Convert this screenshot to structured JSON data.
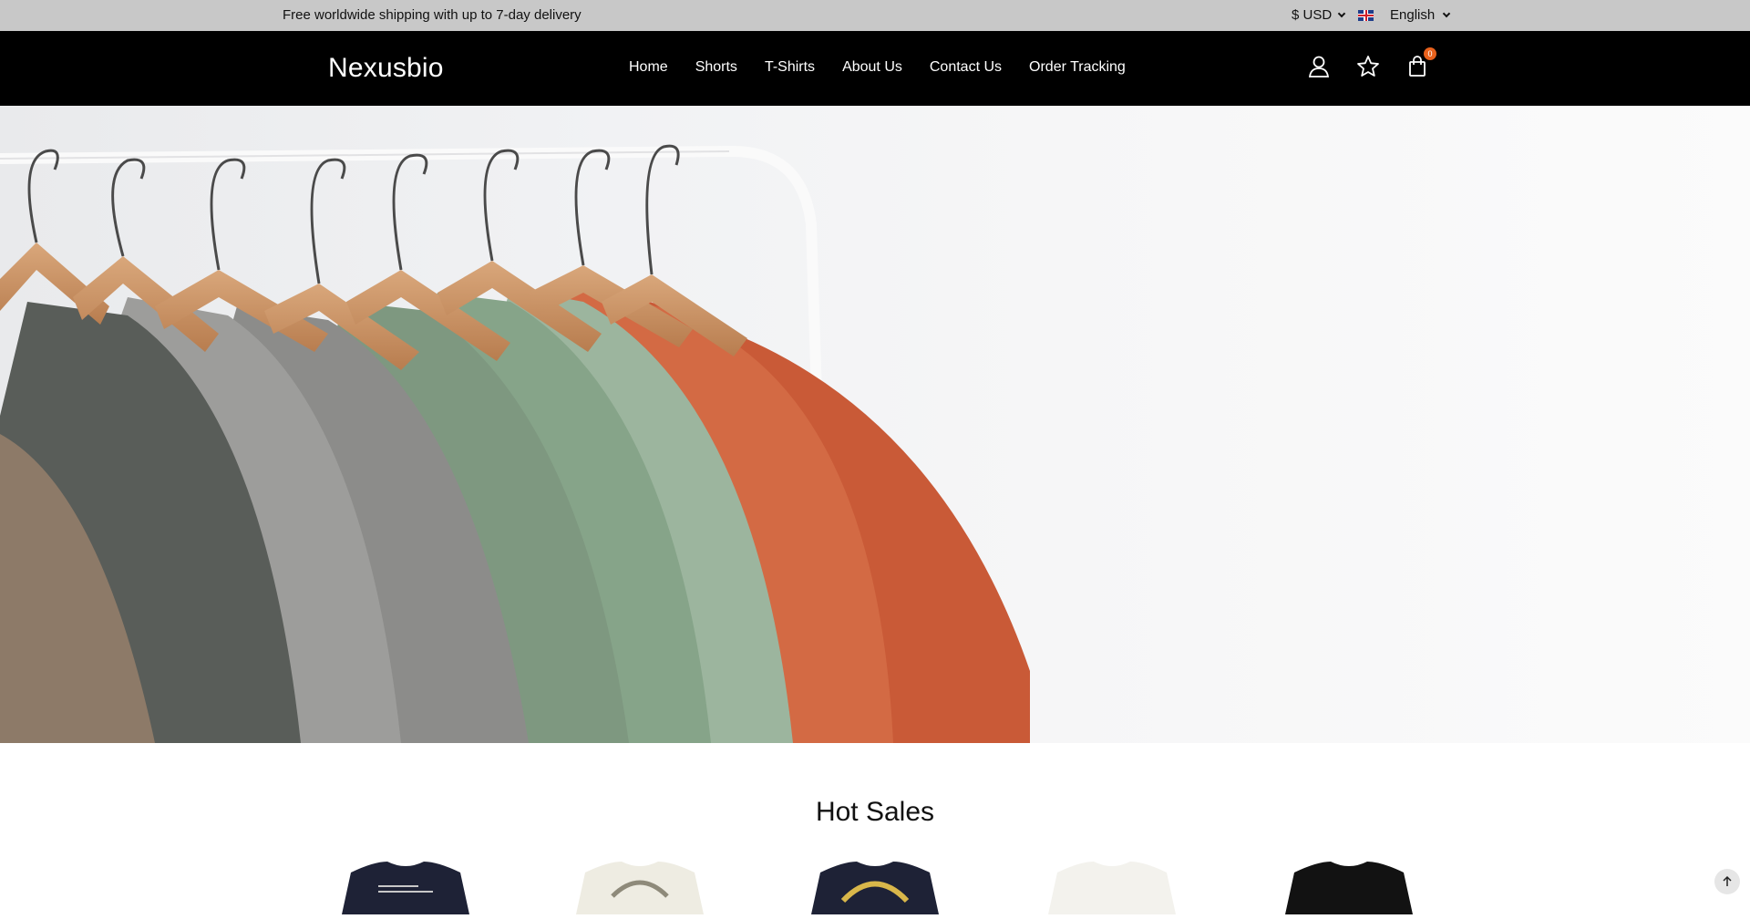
{
  "topbar": {
    "message": "Free worldwide shipping with up to 7-day delivery",
    "currency": "$ USD",
    "language": "English"
  },
  "header": {
    "logo": "Nexusbio",
    "nav": [
      {
        "label": "Home"
      },
      {
        "label": "Shorts"
      },
      {
        "label": "T-Shirts"
      },
      {
        "label": "About Us"
      },
      {
        "label": "Contact Us"
      },
      {
        "label": "Order Tracking"
      }
    ],
    "cart_count": "0",
    "icons": [
      "user-icon",
      "star-icon",
      "bag-icon"
    ]
  },
  "hero": {
    "image": "clothes-on-hangers-photo"
  },
  "hot_sales": {
    "title": "Hot Sales",
    "products": [
      {
        "image": "navy-tshirt-print"
      },
      {
        "image": "cream-tshirt-island-of-gods"
      },
      {
        "image": "navy-tshirt-island-of-gods"
      },
      {
        "image": "white-tshirt"
      },
      {
        "image": "black-tshirt"
      }
    ]
  },
  "colors": {
    "topbar_bg": "#c8c8c8",
    "header_bg": "#000000",
    "badge": "#e8611c"
  }
}
